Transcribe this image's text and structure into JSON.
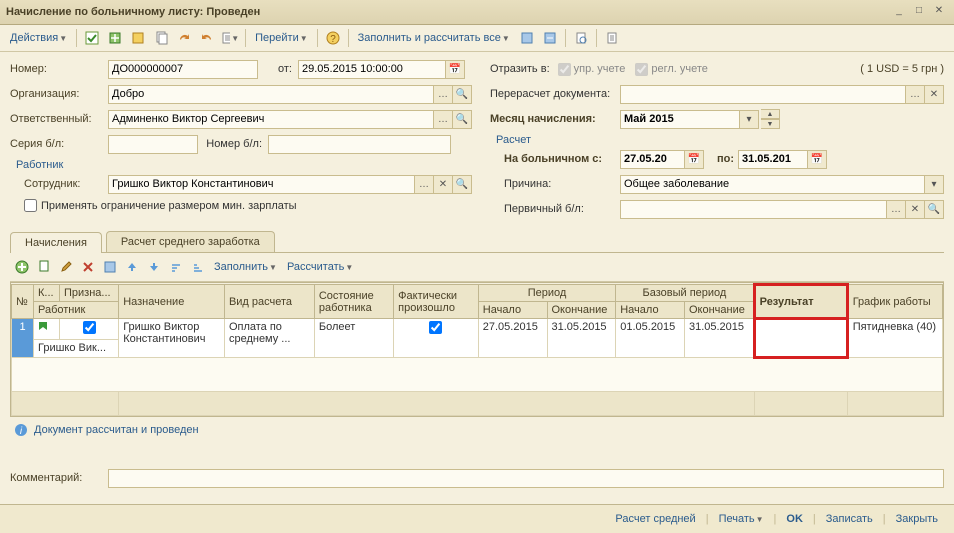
{
  "window": {
    "title": "Начисление по больничному листу: Проведен"
  },
  "toolbar": {
    "actions": "Действия",
    "goto": "Перейти",
    "fillcalc": "Заполнить и рассчитать все"
  },
  "fields": {
    "number_label": "Номер:",
    "number": "ДО000000007",
    "date_label": "от:",
    "date": "29.05.2015 10:00:00",
    "org_label": "Организация:",
    "org": "Добро",
    "resp_label": "Ответственный:",
    "resp": "Админенко Виктор Сергеевич",
    "series_label": "Серия б/л:",
    "series": "",
    "numbl_label": "Номер б/л:",
    "numbl": "",
    "worker_section": "Работник",
    "employee_label": "Сотрудник:",
    "employee": "Гришко Виктор Константинович",
    "limit_check": "Применять ограничение размером мин. зарплаты",
    "reflect_label": "Отразить в:",
    "reflect_mgr": "упр. учете",
    "reflect_reg": "регл. учете",
    "rate": "( 1 USD = 5 грн )",
    "recalc_label": "Перерасчет документа:",
    "recalc": "",
    "month_label": "Месяц начисления:",
    "month": "Май 2015",
    "calc_section": "Расчет",
    "sick_from_label": "На больничном с:",
    "sick_from": "27.05.20",
    "sick_to_label": "по:",
    "sick_to": "31.05.201",
    "reason_label": "Причина:",
    "reason": "Общее заболевание",
    "primary_label": "Первичный б/л:",
    "primary": ""
  },
  "tabs": {
    "t1": "Начисления",
    "t2": "Расчет среднего заработка"
  },
  "grid_toolbar": {
    "fill": "Заполнить",
    "calc": "Рассчитать"
  },
  "grid": {
    "h_n": "№",
    "h_k": "К...",
    "h_prizn": "Призна...",
    "h_assign": "Назначение",
    "h_worker": "Работник",
    "h_calctype": "Вид расчета",
    "h_state": "Состояние работника",
    "h_fact": "Фактически произошло",
    "h_period": "Период",
    "h_base": "Базовый период",
    "h_start": "Начало",
    "h_end": "Окончание",
    "h_result": "Результат",
    "h_schedule": "График работы",
    "r1": {
      "n": "1",
      "assign": "Гришко Виктор Константинович",
      "worker": "Гришко Вик...",
      "calctype": "Оплата по среднему ...",
      "state": "Болеет",
      "pstart": "27.05.2015",
      "pend": "31.05.2015",
      "bstart": "01.05.2015",
      "bend": "31.05.2015",
      "result": "",
      "schedule": "Пятидневка (40)"
    }
  },
  "info": "Документ рассчитан и проведен",
  "comment_label": "Комментарий:",
  "comment": "",
  "bottom": {
    "calc_avg": "Расчет средней",
    "print": "Печать",
    "ok": "OK",
    "save": "Записать",
    "close": "Закрыть"
  }
}
